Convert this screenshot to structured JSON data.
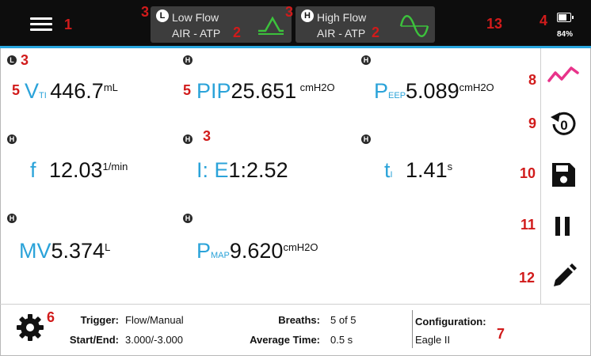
{
  "topbar": {
    "low_flow": {
      "badge": "L",
      "title": "Low Flow",
      "gas": "AIR - ATP"
    },
    "high_flow": {
      "badge": "H",
      "title": "High Flow",
      "gas": "AIR - ATP"
    },
    "battery_text": "84%",
    "battery_level": 0.84
  },
  "callouts": {
    "c1": "1",
    "c2a": "2",
    "c2b": "2",
    "c3a": "3",
    "c3b": "3",
    "c3c": "3",
    "c3d": "3",
    "c4": "4",
    "c5a": "5",
    "c5b": "5",
    "c6": "6",
    "c7": "7",
    "c8": "8",
    "c9": "9",
    "c10": "10",
    "c11": "11",
    "c12": "12",
    "c13": "13"
  },
  "badges": {
    "h": "H",
    "l": "L"
  },
  "metrics": {
    "vti": {
      "symbol": "V",
      "sub": "TI",
      "value": "446.7",
      "unit": "mL"
    },
    "pip": {
      "symbol": "PIP",
      "value": "25.651",
      "unit": "cmH2O"
    },
    "peep": {
      "symbol": "P",
      "sub": "EEP",
      "value": "5.089",
      "unit": "cmH2O"
    },
    "f": {
      "symbol": "f",
      "value": "12.03",
      "unit": "1/min"
    },
    "ie": {
      "symbol": "I: E",
      "value": "1:2.52"
    },
    "ti": {
      "symbol": "t",
      "sub": "I",
      "value": "1.41",
      "unit": "s"
    },
    "mv": {
      "symbol": "MV",
      "value": "5.374",
      "unit": "L"
    },
    "pmap": {
      "symbol": "P",
      "sub": "MAP",
      "value": "9.620",
      "unit": "cmH2O"
    }
  },
  "bottom": {
    "trigger_label": "Trigger:",
    "trigger_value": "Flow/Manual",
    "startend_label": "Start/End:",
    "startend_value": "3.000/-3.000",
    "breaths_label": "Breaths:",
    "breaths_value": "5 of 5",
    "avgtime_label": "Average Time:",
    "avgtime_value": "0.5 s",
    "config_label": "Configuration:",
    "config_value": "Eagle II"
  },
  "icons": {
    "menu": "hamburger-menu-icon",
    "low_wave": "low-flow-wave-icon",
    "high_wave": "high-flow-wave-icon",
    "battery": "battery-icon",
    "graph": "graph-icon",
    "zero": "zero-reset-icon",
    "save": "save-icon",
    "pause": "pause-icon",
    "edit": "pencil-icon",
    "settings": "gear-icon"
  },
  "colors": {
    "accent": "#2ba3d9",
    "callout": "#d11b1b",
    "graph": "#e8338a",
    "wave": "#3cc23c"
  }
}
